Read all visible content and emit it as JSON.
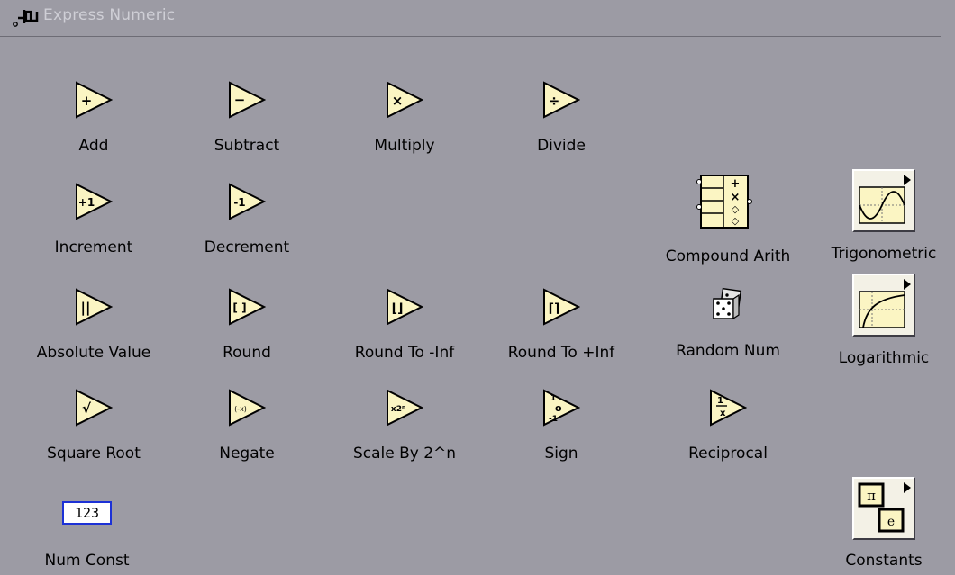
{
  "palette": {
    "title": "Express Numeric",
    "items": [
      {
        "label": "Add",
        "glyph": "+",
        "icon": "add-icon"
      },
      {
        "label": "Subtract",
        "glyph": "−",
        "icon": "subtract-icon"
      },
      {
        "label": "Multiply",
        "glyph": "×",
        "icon": "multiply-icon"
      },
      {
        "label": "Divide",
        "glyph": "÷",
        "icon": "divide-icon"
      },
      {
        "label": "Increment",
        "glyph": "+1",
        "icon": "increment-icon"
      },
      {
        "label": "Decrement",
        "glyph": "-1",
        "icon": "decrement-icon"
      },
      {
        "label": "Compound Arith",
        "icon": "compound-arith-icon"
      },
      {
        "label": "Trigonometric",
        "icon": "trigonometric-icon"
      },
      {
        "label": "Absolute Value",
        "glyph": "||",
        "icon": "absolute-value-icon"
      },
      {
        "label": "Round",
        "glyph": "[ ]",
        "icon": "round-icon"
      },
      {
        "label": "Round To -Inf",
        "glyph": "⌊⌋",
        "icon": "round-to-neg-inf-icon"
      },
      {
        "label": "Round To +Inf",
        "glyph": "⌈⌉",
        "icon": "round-to-pos-inf-icon"
      },
      {
        "label": "Random Num",
        "icon": "dice-icon"
      },
      {
        "label": "Logarithmic",
        "icon": "logarithmic-icon"
      },
      {
        "label": "Square Root",
        "glyph": "√",
        "icon": "square-root-icon"
      },
      {
        "label": "Negate",
        "glyph": "(-x)",
        "icon": "negate-icon"
      },
      {
        "label": "Scale By 2^n",
        "glyph": "x2ⁿ",
        "icon": "scale-by-power-icon"
      },
      {
        "label": "Sign",
        "glyph": "1 0 -1",
        "icon": "sign-icon"
      },
      {
        "label": "Reciprocal",
        "glyph": "1/x",
        "icon": "reciprocal-icon"
      },
      {
        "label": "Num Const",
        "value": "123",
        "icon": "num-const-icon"
      },
      {
        "label": "Constants",
        "icon": "constants-icon"
      }
    ]
  },
  "colors": {
    "background": "#9c9ba4",
    "icon_fill": "#fbf5c3",
    "num_const_border": "#1c31d6"
  }
}
